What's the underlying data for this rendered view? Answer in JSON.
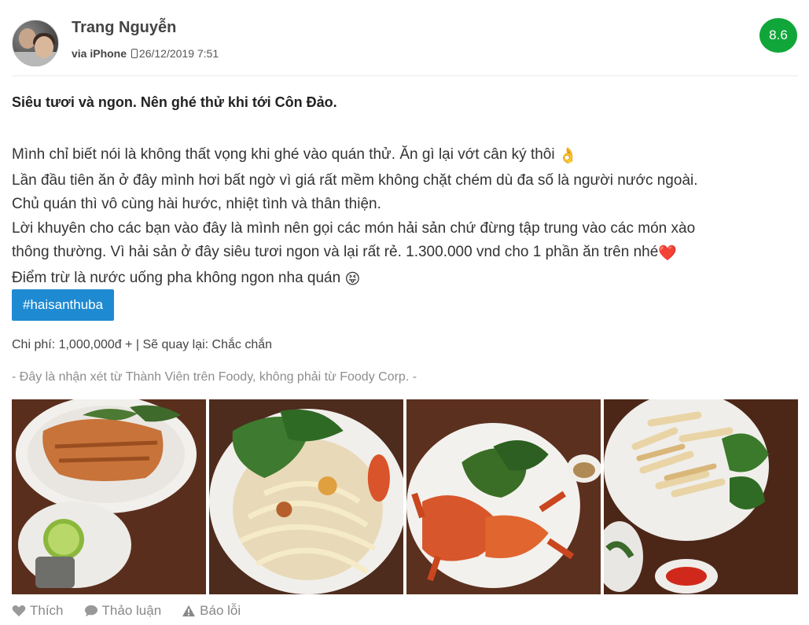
{
  "review": {
    "author": "Trang Nguyễn",
    "via": "via iPhone",
    "date": "26/12/2019 7:51",
    "score": "8.6",
    "title": "Siêu tươi và ngon. Nên ghé thử khi tới Côn Đảo.",
    "body_lines": [
      "Mình chỉ biết nói là không thất vọng khi ghé vào quán thử. Ăn gì lại vớt cân ký thôi",
      "Lần đầu tiên ăn ở đây mình hơi bất ngờ vì giá rất mềm không chặt chém dù đa số là người nước ngoài.",
      "Chủ quán thì vô cùng hài hước, nhiệt tình và thân thiện.",
      "Lời khuyên cho các bạn vào đây là mình nên gọi các món hải sản chứ đừng tập trung vào các món xào",
      "thông thường. Vì hải sản ở đây siêu tươi ngon và lại rất rẻ. 1.300.000 vnd cho 1 phần ăn trên nhé",
      "Điểm trừ là nước uống pha không ngon nha quán"
    ],
    "emoji_ok": "👌",
    "emoji_heart": "❤️",
    "emoji_tongue": "😝",
    "tag": "#haisanthuba",
    "cost_line": "Chi phí: 1,000,000đ + | Sẽ quay lại: Chắc chắn",
    "disclaimer": "- Đây là nhận xét từ Thành Viên trên Foody, không phải từ Foody Corp. -"
  },
  "actions": {
    "like": "Thích",
    "discuss": "Thảo luận",
    "report": "Báo lỗi"
  },
  "icons": {
    "like": "heart-icon",
    "discuss": "speech-bubble-icon",
    "report": "warning-icon",
    "device": "phone-icon"
  },
  "colors": {
    "score_bg": "#11a63a",
    "tag_bg": "#1e8ad2"
  }
}
